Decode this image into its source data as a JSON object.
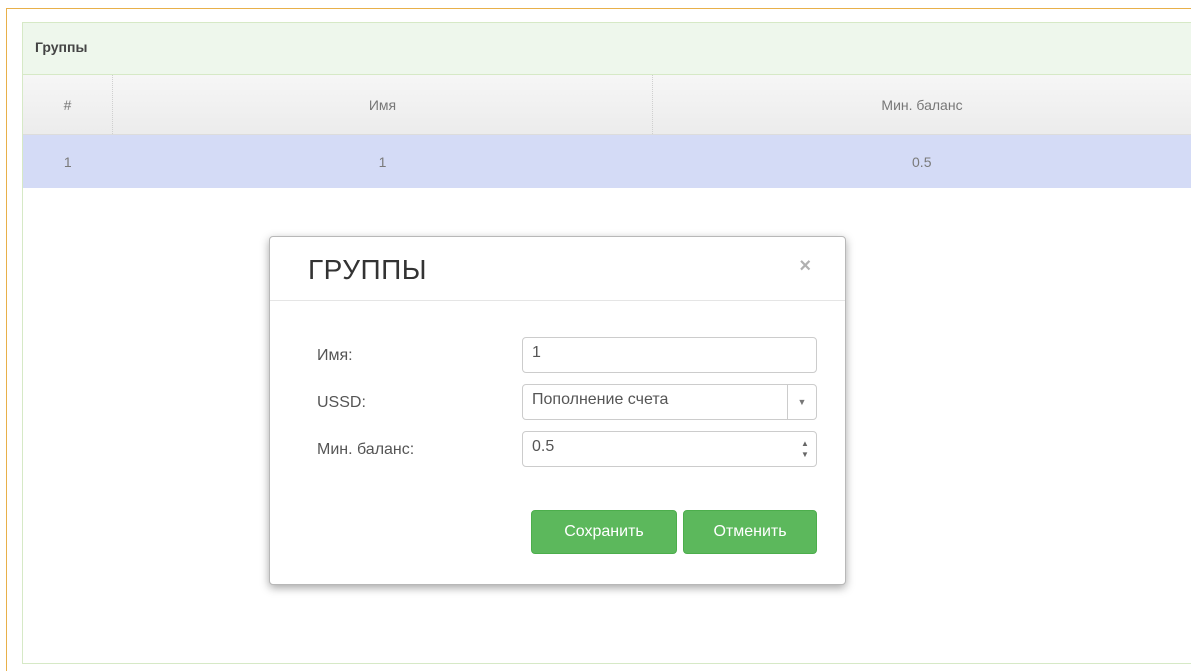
{
  "panel": {
    "title": "Группы"
  },
  "table": {
    "columns": [
      "#",
      "Имя",
      "Мин. баланс"
    ],
    "rows": [
      {
        "num": "1",
        "name": "1",
        "min_balance": "0.5"
      }
    ]
  },
  "modal": {
    "title": "ГРУППЫ",
    "close_glyph": "×",
    "fields": {
      "name": {
        "label": "Имя:",
        "value": "1"
      },
      "ussd": {
        "label": "USSD:",
        "value": "Пополнение счета"
      },
      "min_balance": {
        "label": "Мин. баланс:",
        "value": "0.5"
      }
    },
    "save_label": "Сохранить",
    "cancel_label": "Отменить"
  },
  "colors": {
    "accent_green": "#5cb85c",
    "selected_row": "#d4dbf6",
    "panel_heading": "#eef7ec"
  }
}
